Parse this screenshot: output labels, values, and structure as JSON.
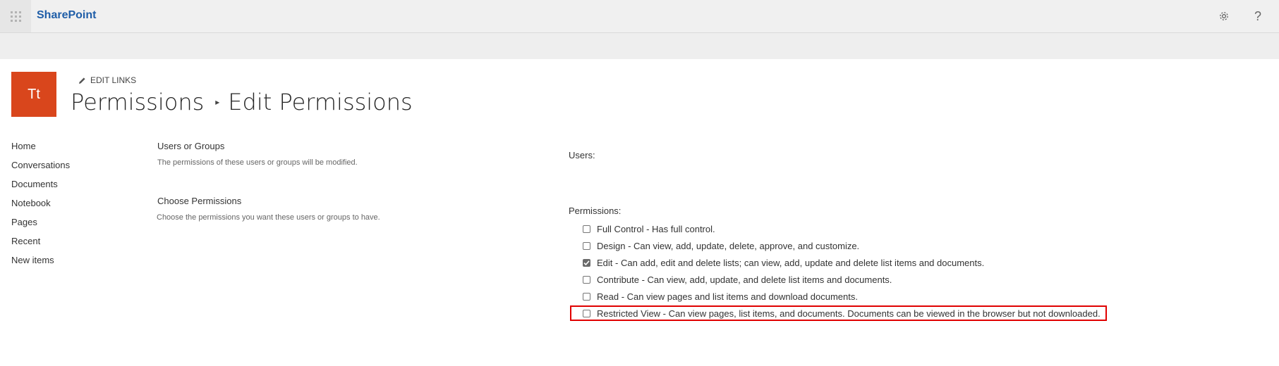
{
  "suite_bar": {
    "brand": "SharePoint",
    "help_icon": "?"
  },
  "site": {
    "logo_initials": "Tt",
    "logo_color": "#d9461c",
    "edit_links": "EDIT LINKS"
  },
  "breadcrumb": {
    "parent": "Permissions",
    "current": "Edit Permissions"
  },
  "quick_launch": [
    "Home",
    "Conversations",
    "Documents",
    "Notebook",
    "Pages",
    "Recent",
    "New items"
  ],
  "sections": {
    "users_groups": {
      "title": "Users or Groups",
      "description": "The permissions of these users or groups will be modified."
    },
    "choose_permissions": {
      "title": "Choose Permissions",
      "description": "Choose the permissions you want these users or groups to have."
    }
  },
  "form": {
    "users_label": "Users:",
    "permissions_label": "Permissions:",
    "permissions": [
      {
        "label": "Full Control - Has full control.",
        "checked": false
      },
      {
        "label": "Design - Can view, add, update, delete, approve, and customize.",
        "checked": false
      },
      {
        "label": "Edit - Can add, edit and delete lists; can view, add, update and delete list items and documents.",
        "checked": true
      },
      {
        "label": "Contribute - Can view, add, update, and delete list items and documents.",
        "checked": false
      },
      {
        "label": "Read - Can view pages and list items and download documents.",
        "checked": false
      },
      {
        "label": "Restricted View - Can view pages, list items, and documents. Documents can be viewed in the browser but not downloaded.",
        "checked": false,
        "highlighted": true
      }
    ]
  },
  "colors": {
    "brand_blue": "#1f5ea8",
    "highlight_red": "#e00000"
  }
}
